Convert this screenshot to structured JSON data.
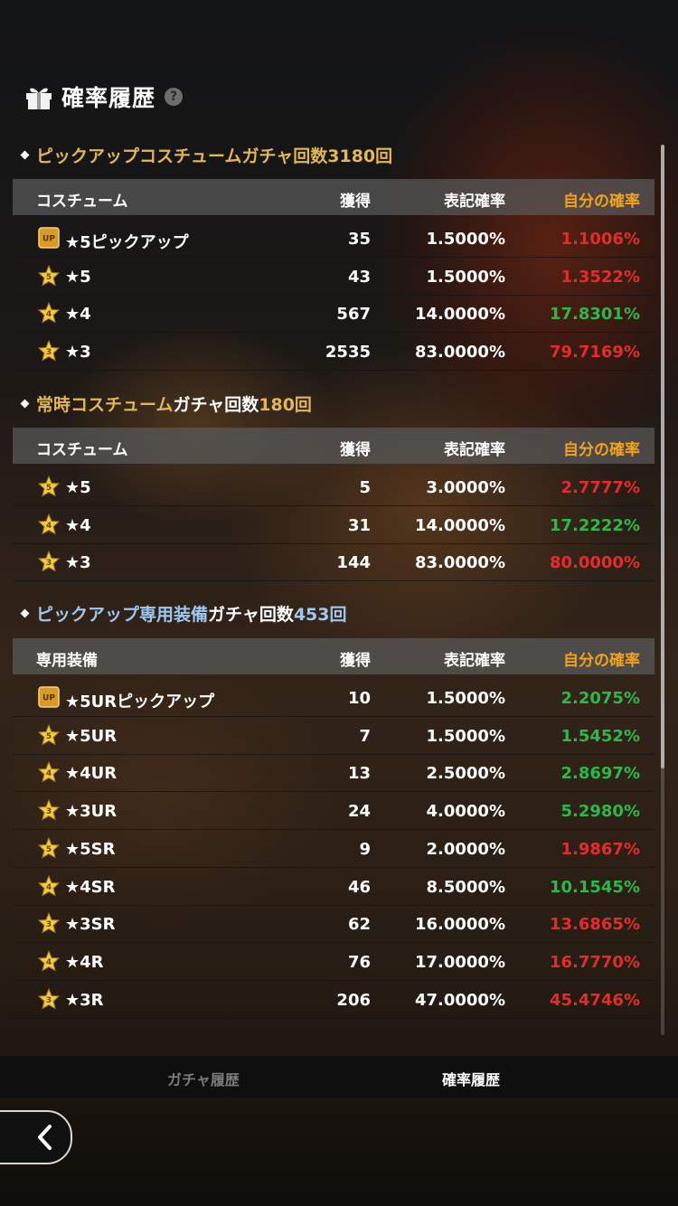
{
  "header": {
    "title": "確率履歴",
    "help_icon": "question-icon",
    "gift_icon": "gift-icon"
  },
  "sections": [
    {
      "title_parts": [
        "ピックアップコスチューム",
        "ガチャ回数",
        "3180回"
      ],
      "title_colors": [
        "gold",
        "gold",
        "gold"
      ],
      "columns": [
        "コスチューム",
        "獲得",
        "表記確率",
        "自分の確率"
      ],
      "rows": [
        {
          "badge": "up-badge-icon",
          "name": "★5ピックアップ",
          "got": "35",
          "rate": "1.5000%",
          "mine": "1.1006%",
          "mine_color": "red"
        },
        {
          "badge": "star5-badge-icon",
          "name": "★5",
          "got": "43",
          "rate": "1.5000%",
          "mine": "1.3522%",
          "mine_color": "red"
        },
        {
          "badge": "star4-badge-icon",
          "name": "★4",
          "got": "567",
          "rate": "14.0000%",
          "mine": "17.8301%",
          "mine_color": "green"
        },
        {
          "badge": "star3-badge-icon",
          "name": "★3",
          "got": "2535",
          "rate": "83.0000%",
          "mine": "79.7169%",
          "mine_color": "red"
        }
      ]
    },
    {
      "title_parts": [
        "常時コスチューム",
        "ガチャ回数",
        "180回"
      ],
      "title_colors": [
        "gold",
        "white",
        "gold"
      ],
      "columns": [
        "コスチューム",
        "獲得",
        "表記確率",
        "自分の確率"
      ],
      "rows": [
        {
          "badge": "star5-badge-icon",
          "name": "★5",
          "got": "5",
          "rate": "3.0000%",
          "mine": "2.7777%",
          "mine_color": "red"
        },
        {
          "badge": "star4-badge-icon",
          "name": "★4",
          "got": "31",
          "rate": "14.0000%",
          "mine": "17.2222%",
          "mine_color": "green"
        },
        {
          "badge": "star3-badge-icon",
          "name": "★3",
          "got": "144",
          "rate": "83.0000%",
          "mine": "80.0000%",
          "mine_color": "red"
        }
      ]
    },
    {
      "title_parts": [
        "ピックアップ専用装備",
        "ガチャ回数",
        "453回"
      ],
      "title_colors": [
        "blue",
        "white",
        "blue"
      ],
      "columns": [
        "専用装備",
        "獲得",
        "表記確率",
        "自分の確率"
      ],
      "rows": [
        {
          "badge": "up-badge-icon",
          "name": "★5URピックアップ",
          "got": "10",
          "rate": "1.5000%",
          "mine": "2.2075%",
          "mine_color": "green"
        },
        {
          "badge": "star5-badge-icon",
          "name": "★5UR",
          "got": "7",
          "rate": "1.5000%",
          "mine": "1.5452%",
          "mine_color": "green"
        },
        {
          "badge": "star4-badge-icon",
          "name": "★4UR",
          "got": "13",
          "rate": "2.5000%",
          "mine": "2.8697%",
          "mine_color": "green"
        },
        {
          "badge": "star3-badge-icon",
          "name": "★3UR",
          "got": "24",
          "rate": "4.0000%",
          "mine": "5.2980%",
          "mine_color": "green"
        },
        {
          "badge": "star5-badge-icon",
          "name": "★5SR",
          "got": "9",
          "rate": "2.0000%",
          "mine": "1.9867%",
          "mine_color": "red"
        },
        {
          "badge": "star4-badge-icon",
          "name": "★4SR",
          "got": "46",
          "rate": "8.5000%",
          "mine": "10.1545%",
          "mine_color": "green"
        },
        {
          "badge": "star3-badge-icon",
          "name": "★3SR",
          "got": "62",
          "rate": "16.0000%",
          "mine": "13.6865%",
          "mine_color": "red"
        },
        {
          "badge": "star4-badge-icon",
          "name": "★4R",
          "got": "76",
          "rate": "17.0000%",
          "mine": "16.7770%",
          "mine_color": "red"
        },
        {
          "badge": "star3-badge-icon",
          "name": "★3R",
          "got": "206",
          "rate": "47.0000%",
          "mine": "45.4746%",
          "mine_color": "red"
        }
      ]
    }
  ],
  "tabs": [
    "ガチャ履歴",
    "確率履歴"
  ],
  "active_tab": "確率履歴",
  "back_icon": "back-arrow-icon",
  "colors": {
    "accent_gold": "#e3b65a",
    "mine_header": "#f3a21f",
    "green": "#2fb84a",
    "red": "#e52c2c",
    "blue": "#9ec8ef"
  }
}
